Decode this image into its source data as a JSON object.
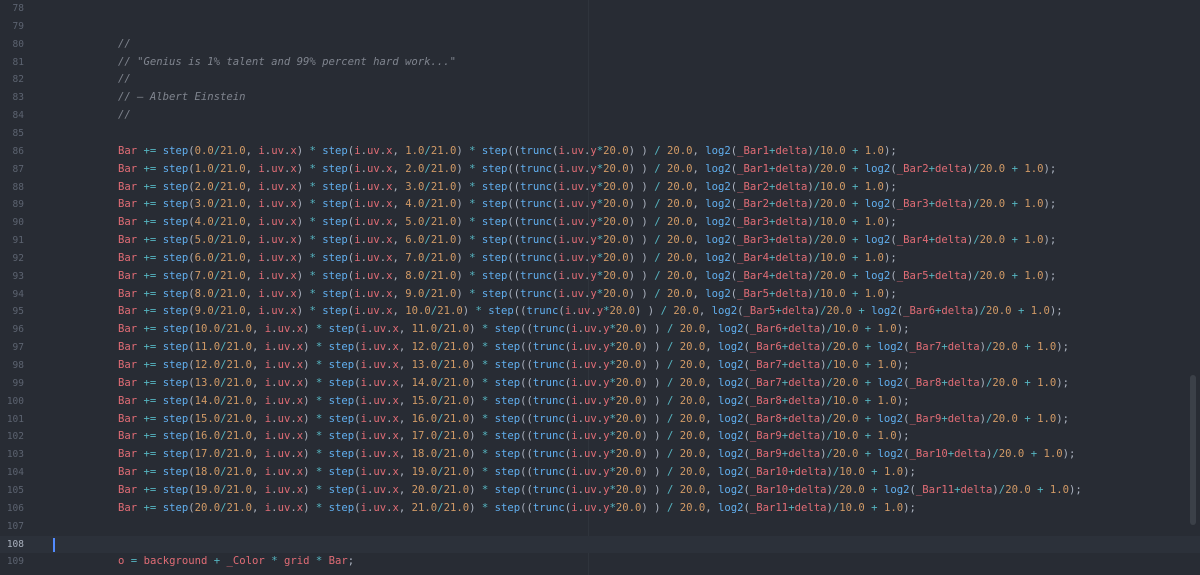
{
  "editor": {
    "language": "hlsl",
    "current_line": 108,
    "colors": {
      "background": "#282c34",
      "current_line_bg": "#2c313a",
      "variable": "#e06c75",
      "function": "#61afef",
      "number": "#d19a66",
      "operator": "#56b6c2",
      "punct": "#abb2bf",
      "comment": "#7f848e",
      "cursor": "#528bff"
    },
    "lines": [
      {
        "num": "78",
        "tokens": []
      },
      {
        "num": "79",
        "tokens": []
      },
      {
        "num": "80",
        "tokens": [
          {
            "t": "//",
            "c": "c"
          }
        ]
      },
      {
        "num": "81",
        "tokens": [
          {
            "t": "// \"Genius is 1% talent and 99% percent hard work...\"",
            "c": "c"
          }
        ]
      },
      {
        "num": "82",
        "tokens": [
          {
            "t": "//",
            "c": "c"
          }
        ]
      },
      {
        "num": "83",
        "tokens": [
          {
            "t": "// — Albert Einstein",
            "c": "c"
          }
        ]
      },
      {
        "num": "84",
        "tokens": [
          {
            "t": "//",
            "c": "c"
          }
        ]
      },
      {
        "num": "85",
        "tokens": []
      },
      {
        "num": "86",
        "code": "Bar += step(0.0/21.0, i.uv.x) * step(i.uv.x, 1.0/21.0) * step((trunc(i.uv.y*20.0) ) / 20.0, log2(_Bar1+delta)/10.0 + 1.0);"
      },
      {
        "num": "87",
        "code": "Bar += step(1.0/21.0, i.uv.x) * step(i.uv.x, 2.0/21.0) * step((trunc(i.uv.y*20.0) ) / 20.0, log2(_Bar1+delta)/20.0 + log2(_Bar2+delta)/20.0 + 1.0);"
      },
      {
        "num": "88",
        "code": "Bar += step(2.0/21.0, i.uv.x) * step(i.uv.x, 3.0/21.0) * step((trunc(i.uv.y*20.0) ) / 20.0, log2(_Bar2+delta)/10.0 + 1.0);"
      },
      {
        "num": "89",
        "code": "Bar += step(3.0/21.0, i.uv.x) * step(i.uv.x, 4.0/21.0) * step((trunc(i.uv.y*20.0) ) / 20.0, log2(_Bar2+delta)/20.0 + log2(_Bar3+delta)/20.0 + 1.0);"
      },
      {
        "num": "90",
        "code": "Bar += step(4.0/21.0, i.uv.x) * step(i.uv.x, 5.0/21.0) * step((trunc(i.uv.y*20.0) ) / 20.0, log2(_Bar3+delta)/10.0 + 1.0);"
      },
      {
        "num": "91",
        "code": "Bar += step(5.0/21.0, i.uv.x) * step(i.uv.x, 6.0/21.0) * step((trunc(i.uv.y*20.0) ) / 20.0, log2(_Bar3+delta)/20.0 + log2(_Bar4+delta)/20.0 + 1.0);"
      },
      {
        "num": "92",
        "code": "Bar += step(6.0/21.0, i.uv.x) * step(i.uv.x, 7.0/21.0) * step((trunc(i.uv.y*20.0) ) / 20.0, log2(_Bar4+delta)/10.0 + 1.0);"
      },
      {
        "num": "93",
        "code": "Bar += step(7.0/21.0, i.uv.x) * step(i.uv.x, 8.0/21.0) * step((trunc(i.uv.y*20.0) ) / 20.0, log2(_Bar4+delta)/20.0 + log2(_Bar5+delta)/20.0 + 1.0);"
      },
      {
        "num": "94",
        "code": "Bar += step(8.0/21.0, i.uv.x) * step(i.uv.x, 9.0/21.0) * step((trunc(i.uv.y*20.0) ) / 20.0, log2(_Bar5+delta)/10.0 + 1.0);"
      },
      {
        "num": "95",
        "code": "Bar += step(9.0/21.0, i.uv.x) * step(i.uv.x, 10.0/21.0) * step((trunc(i.uv.y*20.0) ) / 20.0, log2(_Bar5+delta)/20.0 + log2(_Bar6+delta)/20.0 + 1.0);"
      },
      {
        "num": "96",
        "code": "Bar += step(10.0/21.0, i.uv.x) * step(i.uv.x, 11.0/21.0) * step((trunc(i.uv.y*20.0) ) / 20.0, log2(_Bar6+delta)/10.0 + 1.0);"
      },
      {
        "num": "97",
        "code": "Bar += step(11.0/21.0, i.uv.x) * step(i.uv.x, 12.0/21.0) * step((trunc(i.uv.y*20.0) ) / 20.0, log2(_Bar6+delta)/20.0 + log2(_Bar7+delta)/20.0 + 1.0);"
      },
      {
        "num": "98",
        "code": "Bar += step(12.0/21.0, i.uv.x) * step(i.uv.x, 13.0/21.0) * step((trunc(i.uv.y*20.0) ) / 20.0, log2(_Bar7+delta)/10.0 + 1.0);"
      },
      {
        "num": "99",
        "code": "Bar += step(13.0/21.0, i.uv.x) * step(i.uv.x, 14.0/21.0) * step((trunc(i.uv.y*20.0) ) / 20.0, log2(_Bar7+delta)/20.0 + log2(_Bar8+delta)/20.0 + 1.0);"
      },
      {
        "num": "100",
        "code": "Bar += step(14.0/21.0, i.uv.x) * step(i.uv.x, 15.0/21.0) * step((trunc(i.uv.y*20.0) ) / 20.0, log2(_Bar8+delta)/10.0 + 1.0);"
      },
      {
        "num": "101",
        "code": "Bar += step(15.0/21.0, i.uv.x) * step(i.uv.x, 16.0/21.0) * step((trunc(i.uv.y*20.0) ) / 20.0, log2(_Bar8+delta)/20.0 + log2(_Bar9+delta)/20.0 + 1.0);"
      },
      {
        "num": "102",
        "code": "Bar += step(16.0/21.0, i.uv.x) * step(i.uv.x, 17.0/21.0) * step((trunc(i.uv.y*20.0) ) / 20.0, log2(_Bar9+delta)/10.0 + 1.0);"
      },
      {
        "num": "103",
        "code": "Bar += step(17.0/21.0, i.uv.x) * step(i.uv.x, 18.0/21.0) * step((trunc(i.uv.y*20.0) ) / 20.0, log2(_Bar9+delta)/20.0 + log2(_Bar10+delta)/20.0 + 1.0);"
      },
      {
        "num": "104",
        "code": "Bar += step(18.0/21.0, i.uv.x) * step(i.uv.x, 19.0/21.0) * step((trunc(i.uv.y*20.0) ) / 20.0, log2(_Bar10+delta)/10.0 + 1.0);"
      },
      {
        "num": "105",
        "code": "Bar += step(19.0/21.0, i.uv.x) * step(i.uv.x, 20.0/21.0) * step((trunc(i.uv.y*20.0) ) / 20.0, log2(_Bar10+delta)/20.0 + log2(_Bar11+delta)/20.0 + 1.0);"
      },
      {
        "num": "106",
        "code": "Bar += step(20.0/21.0, i.uv.x) * step(i.uv.x, 21.0/21.0) * step((trunc(i.uv.y*20.0) ) / 20.0, log2(_Bar11+delta)/10.0 + 1.0);"
      },
      {
        "num": "107",
        "tokens": []
      },
      {
        "num": "108",
        "tokens": []
      },
      {
        "num": "109",
        "tokens": [
          {
            "t": "o",
            "c": "v"
          },
          {
            "t": " ",
            "c": "p"
          },
          {
            "t": "=",
            "c": "o"
          },
          {
            "t": " ",
            "c": "p"
          },
          {
            "t": "background",
            "c": "v"
          },
          {
            "t": " ",
            "c": "p"
          },
          {
            "t": "+",
            "c": "o"
          },
          {
            "t": " ",
            "c": "p"
          },
          {
            "t": "_Color",
            "c": "v"
          },
          {
            "t": " ",
            "c": "p"
          },
          {
            "t": "*",
            "c": "o"
          },
          {
            "t": " ",
            "c": "p"
          },
          {
            "t": "grid",
            "c": "v"
          },
          {
            "t": " ",
            "c": "p"
          },
          {
            "t": "*",
            "c": "o"
          },
          {
            "t": " ",
            "c": "p"
          },
          {
            "t": "Bar",
            "c": "v"
          },
          {
            "t": ";",
            "c": "p"
          }
        ]
      }
    ]
  }
}
